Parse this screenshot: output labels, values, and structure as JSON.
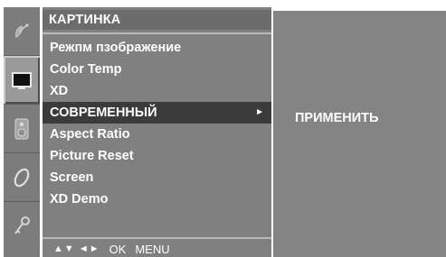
{
  "menu": {
    "title": "КАРТИНКА",
    "items": [
      {
        "label": "Режпм пзображение",
        "arrow": ""
      },
      {
        "label": "Color Temp",
        "arrow": ""
      },
      {
        "label": "XD",
        "arrow": ""
      },
      {
        "label": "СОВРЕМЕННЫЙ",
        "arrow": "►"
      },
      {
        "label": "Aspect Ratio",
        "arrow": ""
      },
      {
        "label": "Picture Reset",
        "arrow": ""
      },
      {
        "label": "Screen",
        "arrow": ""
      },
      {
        "label": "XD Demo",
        "arrow": ""
      }
    ],
    "selected_index": 3
  },
  "footer": {
    "nav_keys": "▲▼ ◄►",
    "ok_label": "OK",
    "menu_label": "MENU"
  },
  "submenu": {
    "option": "ПРИМЕНИТЬ"
  },
  "sidebar_icons": [
    "satellite-dish-icon",
    "picture-icon",
    "speaker-icon",
    "clock-icon",
    "key-icon"
  ],
  "colors": {
    "panel": "#808080",
    "title_bar": "#6c6c6c",
    "selected_row": "#3b3b3b",
    "text": "#ffffff"
  }
}
